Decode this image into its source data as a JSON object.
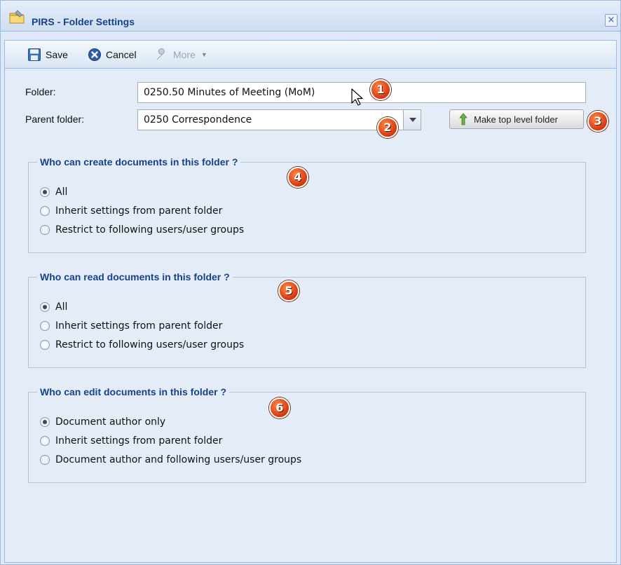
{
  "window": {
    "title": "PIRS - Folder Settings",
    "close_label": "×"
  },
  "toolbar": {
    "save_label": "Save",
    "cancel_label": "Cancel",
    "more_label": "More"
  },
  "form": {
    "folder_label": "Folder:",
    "folder_value": "0250.50 Minutes of Meeting (MoM)",
    "parent_label": "Parent folder:",
    "parent_value": "0250 Correspondence",
    "make_top_label": "Make top level folder"
  },
  "badges": [
    "1",
    "2",
    "3",
    "4",
    "5",
    "6"
  ],
  "groups": [
    {
      "legend": "Who can create documents in this folder ?",
      "options": [
        "All",
        "Inherit settings from parent folder",
        "Restrict to following users/user groups"
      ],
      "selected_index": 0
    },
    {
      "legend": "Who can read documents in this folder ?",
      "options": [
        "All",
        "Inherit settings from parent folder",
        "Restrict to following users/user groups"
      ],
      "selected_index": 0
    },
    {
      "legend": "Who can edit documents in this folder ?",
      "options": [
        "Document author only",
        "Inherit settings from parent folder",
        "Document author and following users/user groups"
      ],
      "selected_index": 0
    }
  ],
  "colors": {
    "title_blue": "#15428b",
    "badge_orange": "#d8340c",
    "panel_bg": "#e4ecf8"
  }
}
